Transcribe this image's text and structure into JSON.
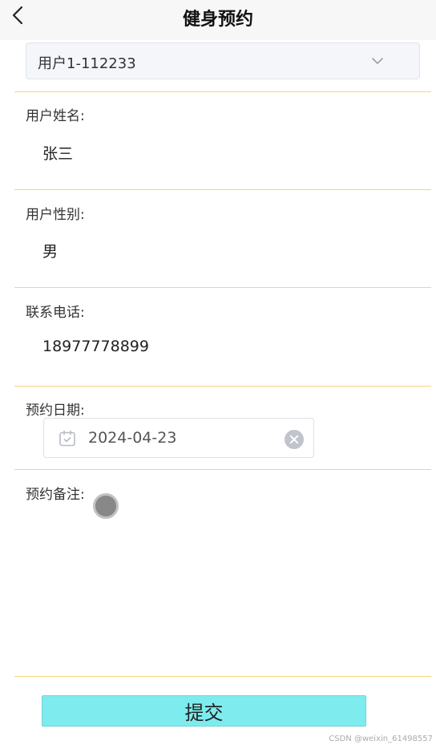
{
  "header": {
    "title": "健身预约",
    "back_icon": "chevron-left-icon"
  },
  "user_select": {
    "value": "用户1-112233",
    "icon": "chevron-down-icon"
  },
  "fields": {
    "name": {
      "label": "用户姓名:",
      "value": "张三"
    },
    "gender": {
      "label": "用户性别:",
      "value": "男"
    },
    "phone": {
      "label": "联系电话:",
      "value": "18977778899"
    },
    "date": {
      "label": "预约日期:",
      "value": "2024-04-23",
      "icon": "calendar-icon",
      "clear_icon": "clear-icon"
    },
    "remark": {
      "label": "预约备注:",
      "value": ""
    }
  },
  "submit": {
    "label": "提交"
  },
  "watermark": "CSDN @weixin_61498557",
  "colors": {
    "divider": "#f6d57a",
    "submit_bg": "#7eebef",
    "nav_bg": "#f7f7f7"
  }
}
